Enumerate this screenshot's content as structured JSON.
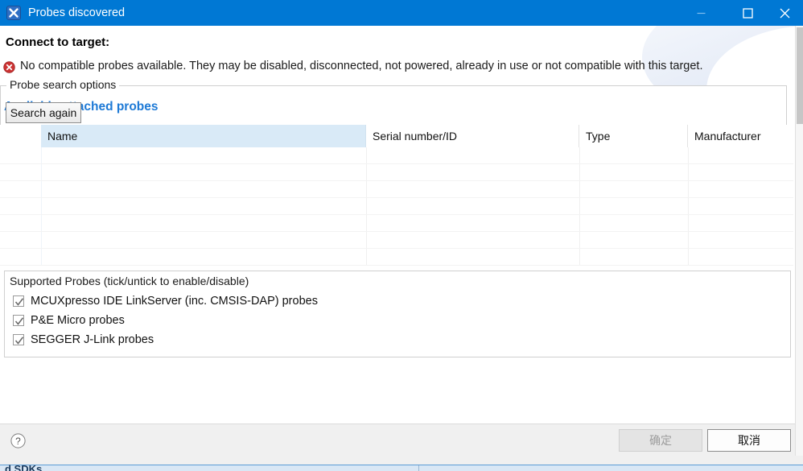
{
  "window": {
    "title": "Probes discovered",
    "icon": "mcuxpresso-x-icon",
    "accent_color": "#0078d4",
    "controls": {
      "minimize": "minimize-icon",
      "maximize": "maximize-icon",
      "close": "close-icon"
    }
  },
  "banner": {
    "title": "Connect to target:",
    "message": "No compatible probes available. They may be disabled, disconnected, not powered, already in use or not compatible with this target.",
    "status_icon": "error-icon",
    "status_color": "#cc3333"
  },
  "main": {
    "section_title": "Available attached probes",
    "section_title_color": "#1e7ad6",
    "table": {
      "columns": [
        {
          "label": "Name",
          "sorted": true
        },
        {
          "label": "Serial number/ID",
          "sorted": false
        },
        {
          "label": "Type",
          "sorted": false
        },
        {
          "label": "Manufacturer",
          "sorted": false
        }
      ],
      "rows": [],
      "empty_row_count": 7
    },
    "supported_probes": {
      "label": "Supported Probes (tick/untick to enable/disable)",
      "items": [
        {
          "label": "MCUXpresso IDE LinkServer (inc. CMSIS-DAP) probes",
          "checked": true
        },
        {
          "label": "P&E Micro probes",
          "checked": true
        },
        {
          "label": "SEGGER J-Link probes",
          "checked": true
        }
      ]
    },
    "search_options": {
      "legend": "Probe search options",
      "search_again_label": "Search again"
    }
  },
  "footer": {
    "help_label": "?",
    "ok_label": "确定",
    "ok_enabled": false,
    "cancel_label": "取消",
    "cancel_enabled": true
  },
  "background_window": {
    "text": "d SDKs"
  }
}
